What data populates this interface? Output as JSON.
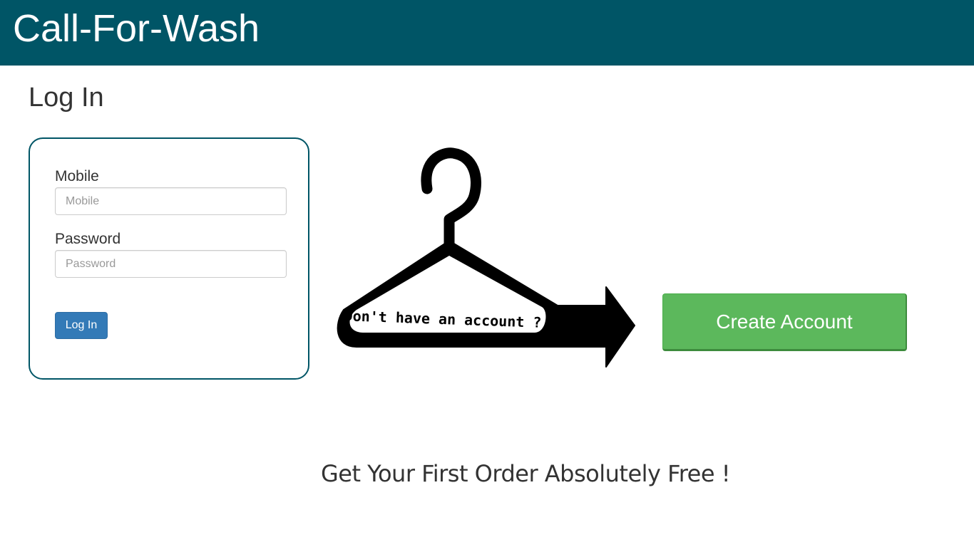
{
  "header": {
    "brand": "Call-For-Wash",
    "background_color": "#005566"
  },
  "page": {
    "title": "Log In"
  },
  "login_form": {
    "mobile_label": "Mobile",
    "mobile_placeholder": "Mobile",
    "mobile_value": "",
    "password_label": "Password",
    "password_placeholder": "Password",
    "password_value": "",
    "submit_label": "Log In",
    "submit_color": "#337ab7"
  },
  "signup_promo": {
    "hanger_text": "Don't have an account ?",
    "hanger_icon": "clothes-hanger-arrow-icon",
    "create_account_label": "Create Account",
    "create_account_color": "#5cb85c"
  },
  "footer_promo": {
    "text": "Get Your First Order Absolutely Free !"
  }
}
